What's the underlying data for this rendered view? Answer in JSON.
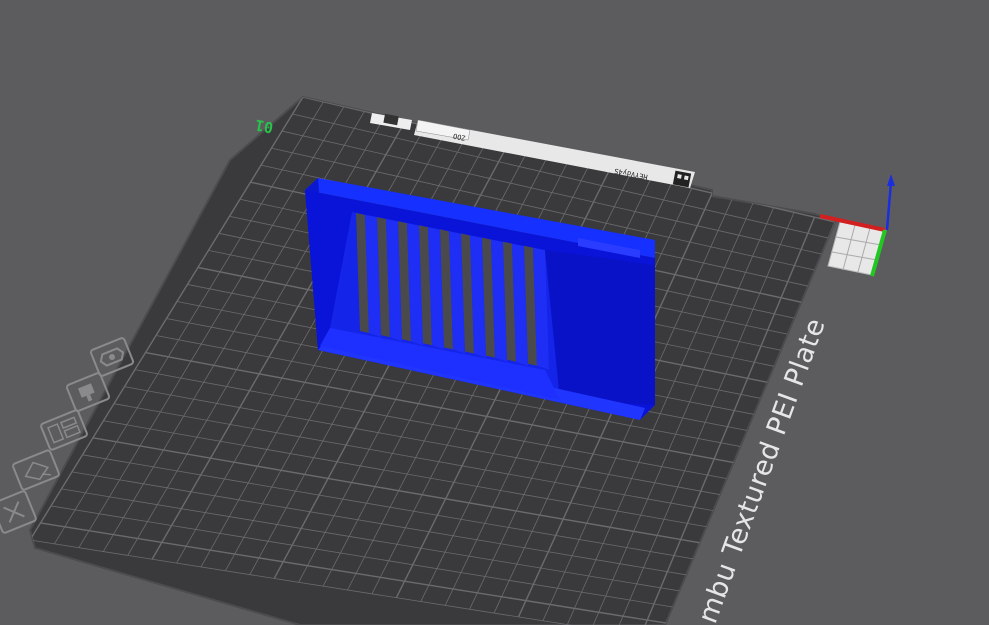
{
  "viewport": {
    "background": "#5c5c5f",
    "plate_color": "#3a3a3c",
    "grid_color": "#6b6b6e",
    "model_color": "#0a14d8"
  },
  "plate": {
    "number": "01",
    "label": "mbu Textured PEI Plate",
    "sticker_code": "HEYVdy4S",
    "sticker_small": "ZOO"
  },
  "toolbar": {
    "icons": [
      {
        "name": "orient-icon"
      },
      {
        "name": "paint-icon"
      },
      {
        "name": "layout-icon"
      },
      {
        "name": "auto-arrange-icon"
      },
      {
        "name": "close-icon"
      }
    ]
  },
  "axis": {
    "x_color": "#d22020",
    "y_color": "#22c822",
    "z_color": "#1a2ee0"
  }
}
